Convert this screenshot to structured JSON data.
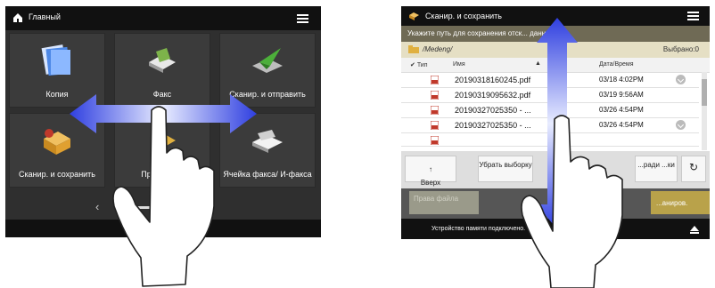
{
  "left_panel": {
    "header_title": "Главный",
    "tiles": [
      {
        "label": "Копия",
        "icon": "copy-icon"
      },
      {
        "label": "Факс",
        "icon": "fax-icon"
      },
      {
        "label": "Сканир. и отправить",
        "icon": "scan-send-icon"
      },
      {
        "label": "Сканир. и сохранить",
        "icon": "scan-store-icon"
      },
      {
        "label": "Пр",
        "icon": "print-icon"
      },
      {
        "label": "Ячейка факса/ И-факса",
        "icon": "fax-inbox-icon"
      }
    ],
    "pager_prev": "‹"
  },
  "right_panel": {
    "header_title": "Сканир. и сохранить",
    "path_text": "Укажите путь для сохранения отск... данных.",
    "folder_name": "/Medeng/",
    "selected_label": "Выбрано:0",
    "columns": {
      "type": "Тип",
      "name": "Имя",
      "sort": "▲",
      "date": "Дата/Время"
    },
    "files": [
      {
        "name": "20190318160245.pdf",
        "date": "03/18 4:02PM",
        "expand": true
      },
      {
        "name": "20190319095632.pdf",
        "date": "03/19 9:56AM",
        "expand": false
      },
      {
        "name": "20190327025350 - ...",
        "date": "03/26 4:54PM",
        "expand": false
      },
      {
        "name": "20190327025350 - ...",
        "date": "03/26 4:54PM",
        "expand": true
      }
    ],
    "toolbar": {
      "up_label": "Вверх",
      "deselect_label": "Убрать выборку",
      "partial_label": "...ради ...ки",
      "refresh_icon": "↻"
    },
    "file_rights_label": "Права файла",
    "scan_button_label": "...аниров.",
    "status_text": "Устройство памяти подключено."
  },
  "colors": {
    "dark_bg": "#2f2f2f",
    "header_bg": "#111111",
    "path_bar": "#6f6a55",
    "folder_bar": "#e5dfc4",
    "accent_gold": "#b9a24a",
    "gesture_blue": "#2f3fe0"
  }
}
